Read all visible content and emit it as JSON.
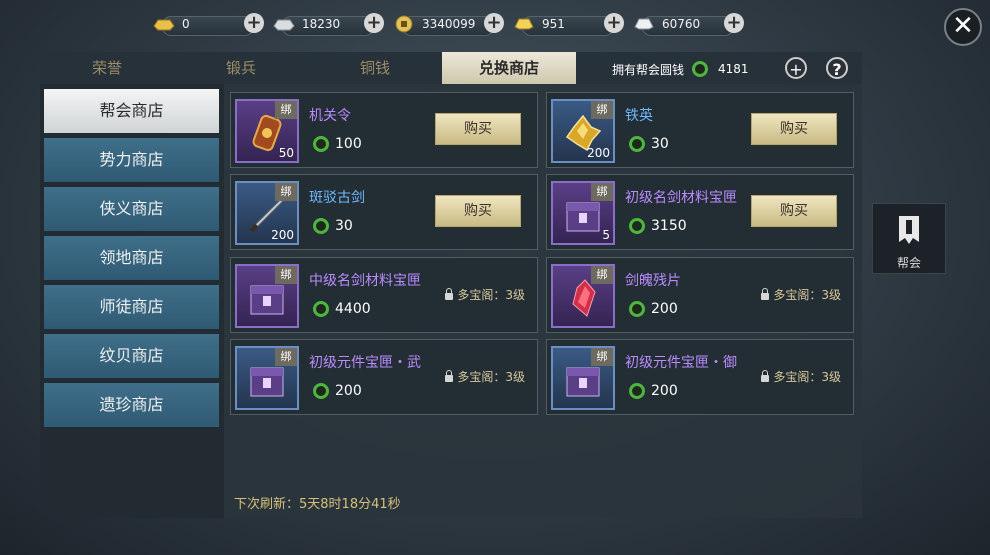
{
  "currencies": [
    {
      "icon": "gold-ingot-icon",
      "value": "0"
    },
    {
      "icon": "silver-ingot-icon",
      "value": "18230"
    },
    {
      "icon": "copper-coin-icon",
      "value": "3340099"
    },
    {
      "icon": "gold-bar-icon",
      "value": "951"
    },
    {
      "icon": "silver-bar-icon",
      "value": "60760"
    }
  ],
  "tabs": [
    "荣誉",
    "锻兵",
    "铜钱",
    "兑换商店"
  ],
  "active_tab": "兑换商店",
  "guild_coins": {
    "label": "拥有帮会圆钱",
    "value": "4181"
  },
  "sidebar": {
    "items": [
      "帮会商店",
      "势力商店",
      "侠义商店",
      "领地商店",
      "师徒商店",
      "纹贝商店",
      "遗珍商店"
    ]
  },
  "items": [
    {
      "name": "机关令",
      "qty": "50",
      "price": "100",
      "action": "购买",
      "bind": "绑"
    },
    {
      "name": "铁英",
      "qty": "200",
      "price": "30",
      "action": "购买",
      "bind": "绑"
    },
    {
      "name": "斑驳古剑",
      "qty": "200",
      "price": "30",
      "action": "购买",
      "bind": "绑"
    },
    {
      "name": "初级名剑材料宝匣",
      "qty": "5",
      "price": "3150",
      "action": "购买",
      "bind": "绑"
    },
    {
      "name": "中级名剑材料宝匣",
      "qty": "",
      "price": "4400",
      "lock": "多宝阁：3级",
      "bind": "绑"
    },
    {
      "name": "剑魄残片",
      "qty": "",
      "price": "200",
      "lock": "多宝阁：3级",
      "bind": "绑"
    },
    {
      "name": "初级元件宝匣・武",
      "qty": "",
      "price": "200",
      "lock": "多宝阁：3级",
      "bind": "绑"
    },
    {
      "name": "初级元件宝匣・御",
      "qty": "",
      "price": "200",
      "lock": "多宝阁：3级",
      "bind": "绑"
    }
  ],
  "refresh": {
    "label": "下次刷新：",
    "value": "5天8时18分41秒"
  },
  "guild_button": "帮会",
  "colors": {
    "accent": "#d6c07a",
    "coin_green": "#4fb53e",
    "name_blue": "#6fb8ff",
    "name_purple": "#b98cff"
  }
}
